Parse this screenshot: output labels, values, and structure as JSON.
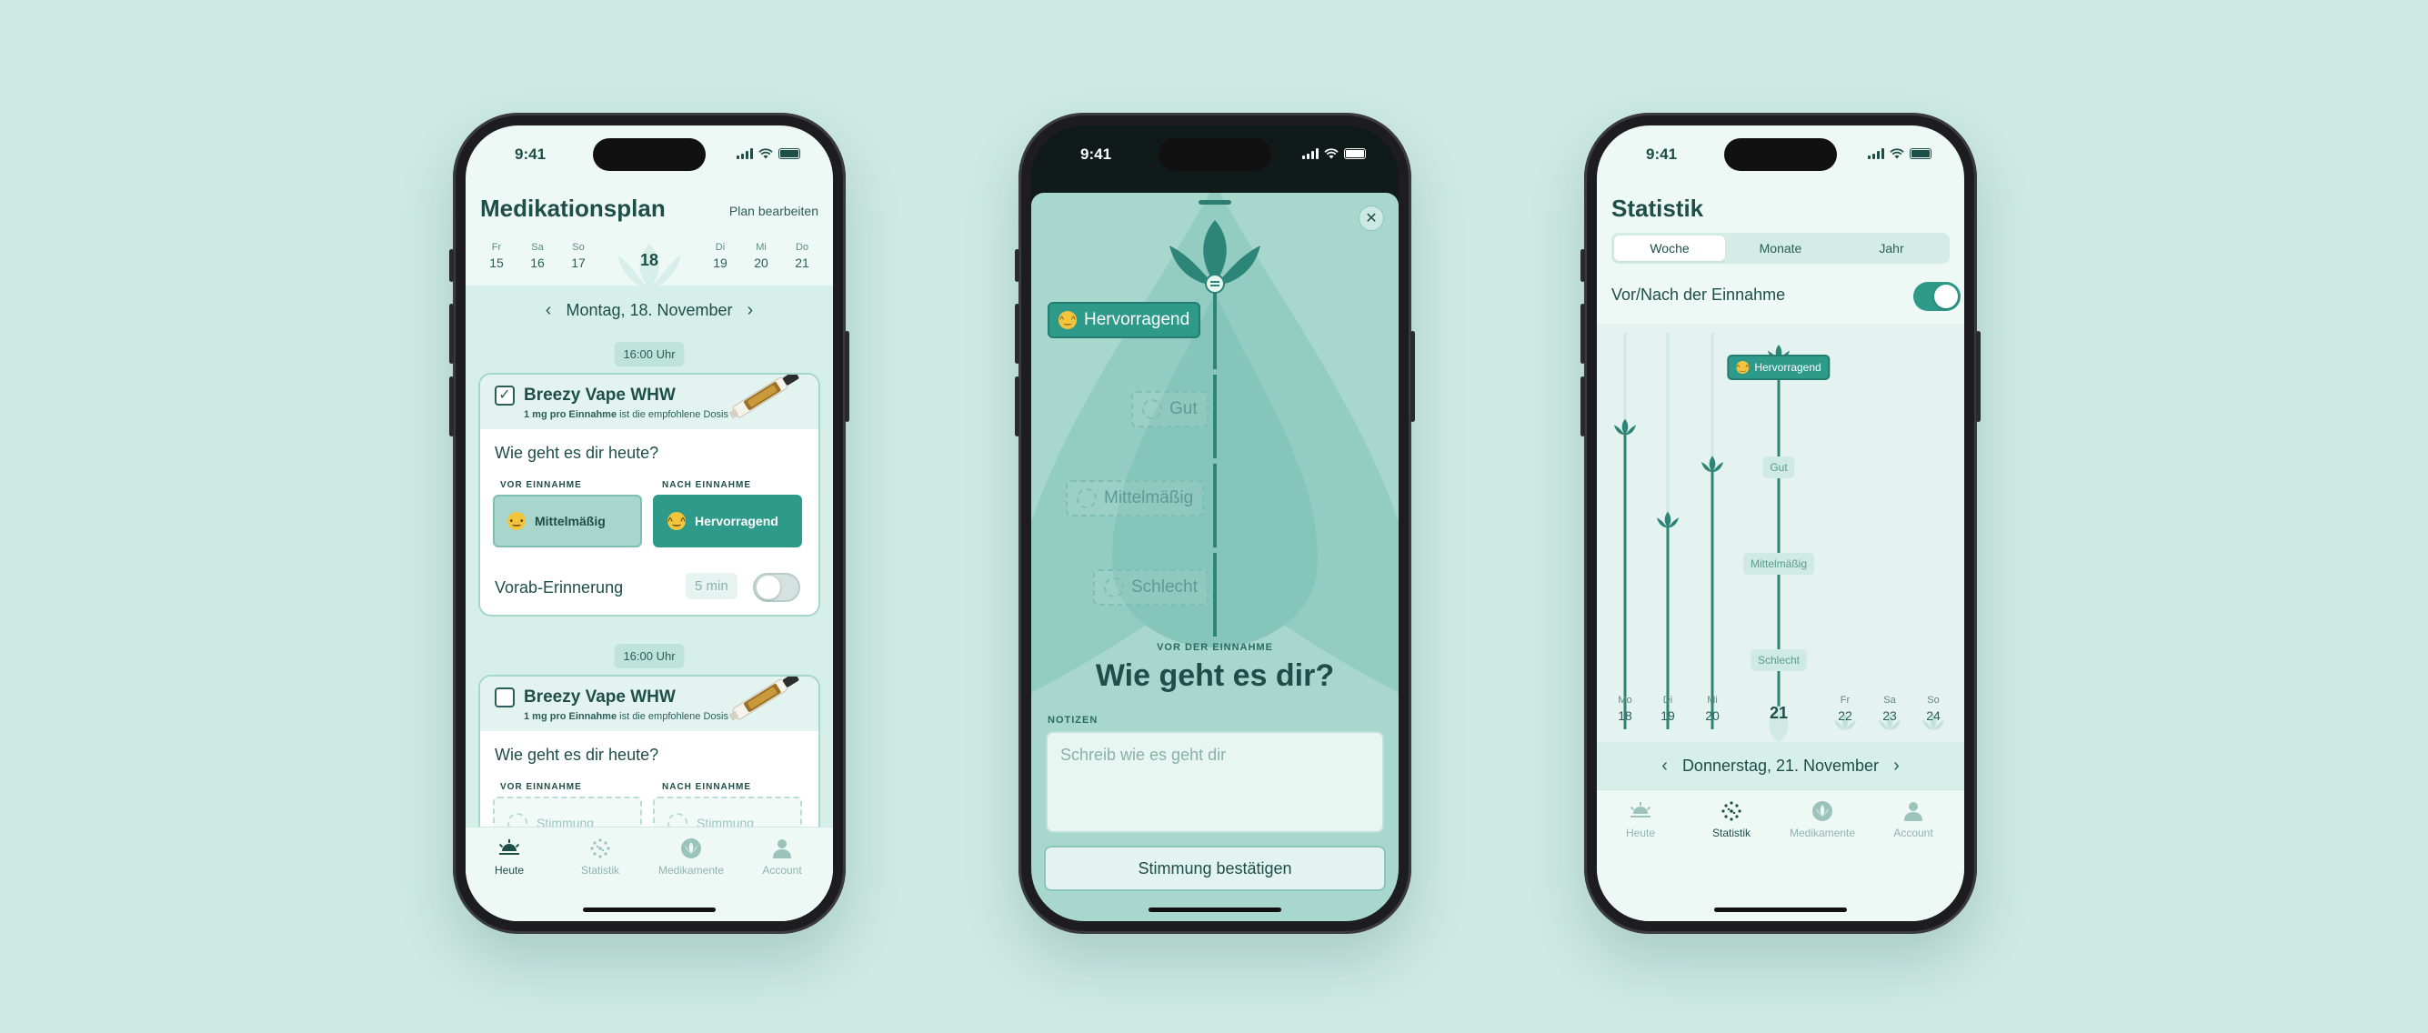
{
  "status": {
    "time": "9:41"
  },
  "phone1": {
    "title": "Medikationsplan",
    "edit_label": "Plan bearbeiten",
    "days": [
      {
        "wd": "Fr",
        "n": "15"
      },
      {
        "wd": "Sa",
        "n": "16"
      },
      {
        "wd": "So",
        "n": "17"
      },
      {
        "wd": "",
        "n": "18"
      },
      {
        "wd": "Di",
        "n": "19"
      },
      {
        "wd": "Mi",
        "n": "20"
      },
      {
        "wd": "Do",
        "n": "21"
      }
    ],
    "date_label": "Montag, 18. November",
    "slots": [
      {
        "time": "16:00 Uhr",
        "checked": true,
        "name": "Breezy Vape WHW",
        "dose_bold": "1 mg pro Einnahme",
        "dose_rest": " ist die empfohlene Dosis",
        "question": "Wie geht es dir heute?",
        "before_label": "VOR EINNAHME",
        "after_label": "NACH EINNAHME",
        "before_value": "Mittelmäßig",
        "after_value": "Hervorragend",
        "reminder_label": "Vorab-Erinnerung",
        "reminder_value": "5 min",
        "reminder_on": false
      },
      {
        "time": "16:00 Uhr",
        "checked": false,
        "name": "Breezy Vape WHW",
        "dose_bold": "1 mg pro Einnahme",
        "dose_rest": " ist die empfohlene Dosis",
        "question": "Wie geht es dir heute?",
        "before_label": "VOR EINNAHME",
        "after_label": "NACH EINNAHME",
        "before_value": "Stimmung",
        "after_value": "Stimmung"
      }
    ]
  },
  "tabs": [
    {
      "label": "Heute",
      "icon": "sunrise-icon"
    },
    {
      "label": "Statistik",
      "icon": "dots-grid-icon"
    },
    {
      "label": "Medikamente",
      "icon": "leaf-icon"
    },
    {
      "label": "Account",
      "icon": "person-icon"
    }
  ],
  "phone2": {
    "levels": [
      "Hervorragend",
      "Gut",
      "Mittelmäßig",
      "Schlecht"
    ],
    "selected": "Hervorragend",
    "eyebrow": "VOR DER EINNAHME",
    "question": "Wie geht es dir?",
    "notes_label": "NOTIZEN",
    "notes_placeholder": "Schreib wie es geht dir",
    "confirm_label": "Stimmung bestätigen"
  },
  "phone3": {
    "title": "Statistik",
    "segments": [
      "Woche",
      "Monate",
      "Jahr"
    ],
    "active_segment": "Woche",
    "toggle_label": "Vor/Nach der Einnahme",
    "toggle_on": true,
    "date_label": "Donnerstag, 21. November"
  },
  "chart_data": {
    "type": "line",
    "categories": [
      {
        "wd": "Mo",
        "n": "18"
      },
      {
        "wd": "Di",
        "n": "19"
      },
      {
        "wd": "Mi",
        "n": "20"
      },
      {
        "wd": "",
        "n": "21"
      },
      {
        "wd": "Fr",
        "n": "22"
      },
      {
        "wd": "Sa",
        "n": "23"
      },
      {
        "wd": "So",
        "n": "24"
      }
    ],
    "levels": [
      "Schlecht",
      "Mittelmäßig",
      "Gut",
      "Hervorragend"
    ],
    "values": [
      3.2,
      2.2,
      2.8,
      4,
      null,
      null,
      null
    ],
    "selected_index": 3,
    "selected_label": "Hervorragend"
  },
  "colors": {
    "accent": "#2d9a8a",
    "dark": "#1e4e48",
    "background": "#cce9e3"
  }
}
